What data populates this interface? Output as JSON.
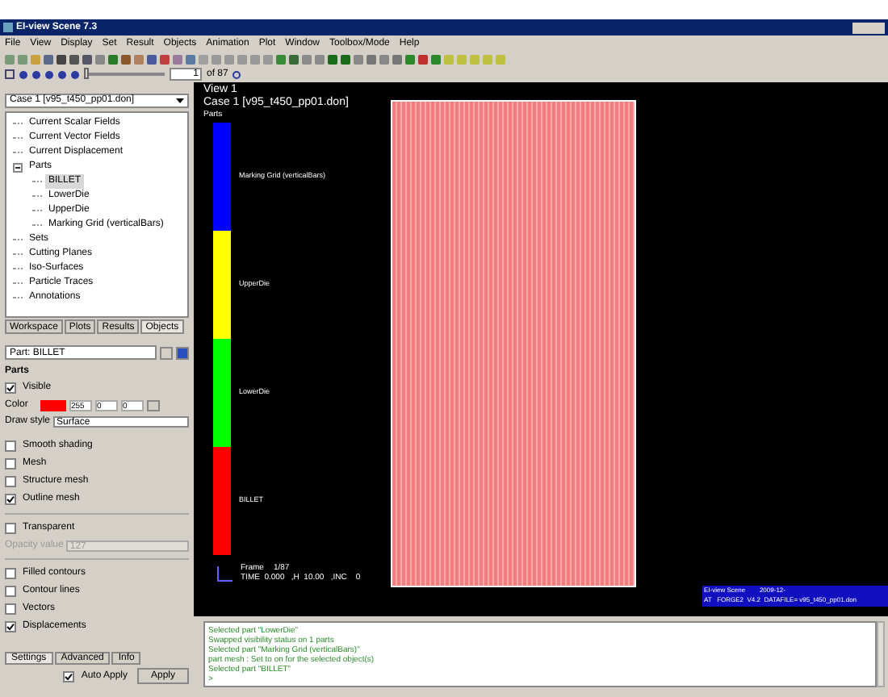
{
  "window": {
    "title": "EI-view Scene 7.3"
  },
  "menu": [
    "File",
    "View",
    "Display",
    "Set",
    "Result",
    "Objects",
    "Animation",
    "Plot",
    "Window",
    "Toolbox/Mode",
    "Help"
  ],
  "frame_bar": {
    "frame": "1",
    "total": "of 87",
    "level": 0
  },
  "case_select": "Case 1 [v95_t450_pp01.don]",
  "tree": [
    {
      "label": "Current Scalar Fields",
      "selected": false
    },
    {
      "label": "Current Vector Fields",
      "selected": false
    },
    {
      "label": "Current Displacement",
      "selected": false
    },
    {
      "label": "Parts",
      "selected": false,
      "expanded": true,
      "children": [
        {
          "label": "BILLET",
          "selected": true
        },
        {
          "label": "LowerDie",
          "selected": false
        },
        {
          "label": "UpperDie",
          "selected": false
        },
        {
          "label": "Marking Grid (verticalBars)",
          "selected": false
        }
      ]
    },
    {
      "label": "Sets",
      "selected": false
    },
    {
      "label": "Cutting Planes",
      "selected": false
    },
    {
      "label": "Iso-Surfaces",
      "selected": false
    },
    {
      "label": "Particle Traces",
      "selected": false
    },
    {
      "label": "Annotations",
      "selected": false
    }
  ],
  "panel_tabs": [
    {
      "label": "Workspace",
      "selected": false
    },
    {
      "label": "Plots",
      "selected": false
    },
    {
      "label": "Results",
      "selected": false
    },
    {
      "label": "Objects",
      "selected": true
    }
  ],
  "part_select": "Part: BILLET",
  "section": "Parts",
  "visible": {
    "label": "Visible",
    "checked": true
  },
  "color": {
    "label": "Color",
    "r": "255",
    "g": "0",
    "b": "0"
  },
  "draw_style": {
    "label": "Draw style",
    "value": "Surface"
  },
  "options": [
    {
      "label": "Smooth shading",
      "checked": false
    },
    {
      "label": "Mesh",
      "checked": false
    },
    {
      "label": "Structure mesh",
      "checked": false
    },
    {
      "label": "Outline mesh",
      "checked": true
    }
  ],
  "transparent": {
    "label": "Transparent",
    "checked": false
  },
  "opacity": {
    "label": "Opacity value",
    "value": "127",
    "disabled": true
  },
  "display_options": [
    {
      "label": "Filled contours",
      "checked": false
    },
    {
      "label": "Contour lines",
      "checked": false
    },
    {
      "label": "Vectors",
      "checked": false
    },
    {
      "label": "Displacements",
      "checked": true
    }
  ],
  "bottom_tabs": [
    {
      "label": "Settings",
      "selected": true
    },
    {
      "label": "Advanced",
      "selected": false
    },
    {
      "label": "Info",
      "selected": false
    }
  ],
  "auto_apply": {
    "label": "Auto Apply",
    "checked": true
  },
  "apply_button": "Apply",
  "view": {
    "title": "View 1",
    "case": "Case 1  [v95_t450_pp01.don]",
    "legend_title": "Parts",
    "legend": [
      {
        "label": "Marking Grid (verticalBars)",
        "color": "#0000ff"
      },
      {
        "label": "UpperDie",
        "color": "#ffff00"
      },
      {
        "label": "LowerDie",
        "color": "#00ff00"
      },
      {
        "label": "BILLET",
        "color": "#ff0000"
      }
    ],
    "frame_label": "Frame",
    "frame_value": "1/87",
    "time_line": "TIME  0.000   ,H  10.00   ,INC    0",
    "info_box": [
      "EI-view Scene        2009-12-",
      "AT   FORGE2  V4.2  DATAFILE= v95_t450_pp01.don"
    ]
  },
  "console": [
    "Selected part \"LowerDie\"",
    "Swapped visibility status on 1 parts",
    "Selected part \"Marking Grid (verticalBars)\"",
    "part mesh : Set to on for the selected object(s)",
    "Selected part \"BILLET\"",
    ">"
  ]
}
